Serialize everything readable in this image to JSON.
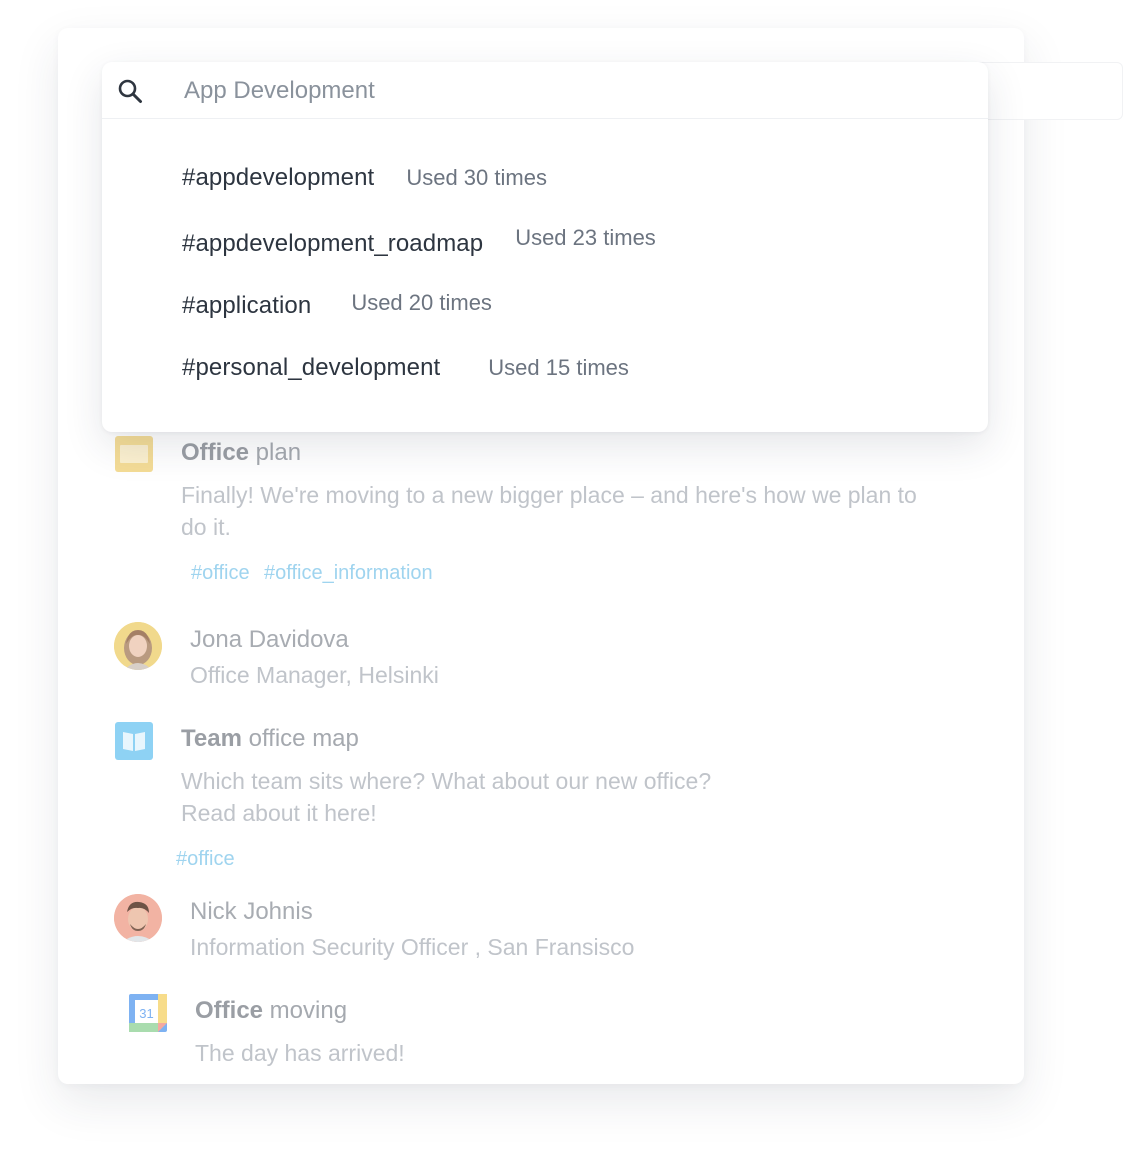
{
  "search": {
    "value": "App Development",
    "placeholder": "App Development"
  },
  "suggestions": [
    {
      "tag": "#appdevelopment",
      "usage": "Used 30 times"
    },
    {
      "tag": "#appdevelopment_roadmap",
      "usage": "Used 23 times"
    },
    {
      "tag": "#application",
      "usage": "Used 20 times"
    },
    {
      "tag": "#personal_development",
      "usage": "Used 15 times"
    }
  ],
  "results": {
    "office_plan": {
      "title_bold": "Office",
      "title_rest": " plan",
      "description": "Finally! We're moving to a new bigger place – and here's how we plan to do it.",
      "tags": [
        "#office",
        "#office_information"
      ],
      "icon": "slides-icon"
    },
    "person1": {
      "name": "Jona Davidova",
      "role": "Office Manager, Helsinki"
    },
    "team_map": {
      "title_bold": "Team",
      "title_rest": " office map",
      "description_line1": "Which team sits where? What about our new office?",
      "description_line2": "Read about it here!",
      "tags": [
        "#office"
      ],
      "icon": "book-icon"
    },
    "person2": {
      "name": "Nick Johnis",
      "role": "Information Security Officer , San Fransisco"
    },
    "office_moving": {
      "title_bold": "Office",
      "title_rest": " moving",
      "description": "The day has arrived!",
      "icon": "calendar-icon",
      "calendar_day": "31"
    }
  },
  "colors": {
    "slides_icon": "#f4dc96",
    "book_icon": "#8ed2f4",
    "hashtag": "#9fd4ef",
    "calendar_blue": "#7eb2f2",
    "calendar_green": "#a9dcae",
    "calendar_yellow": "#f7dc8a",
    "calendar_red": "#f4a9a0"
  }
}
